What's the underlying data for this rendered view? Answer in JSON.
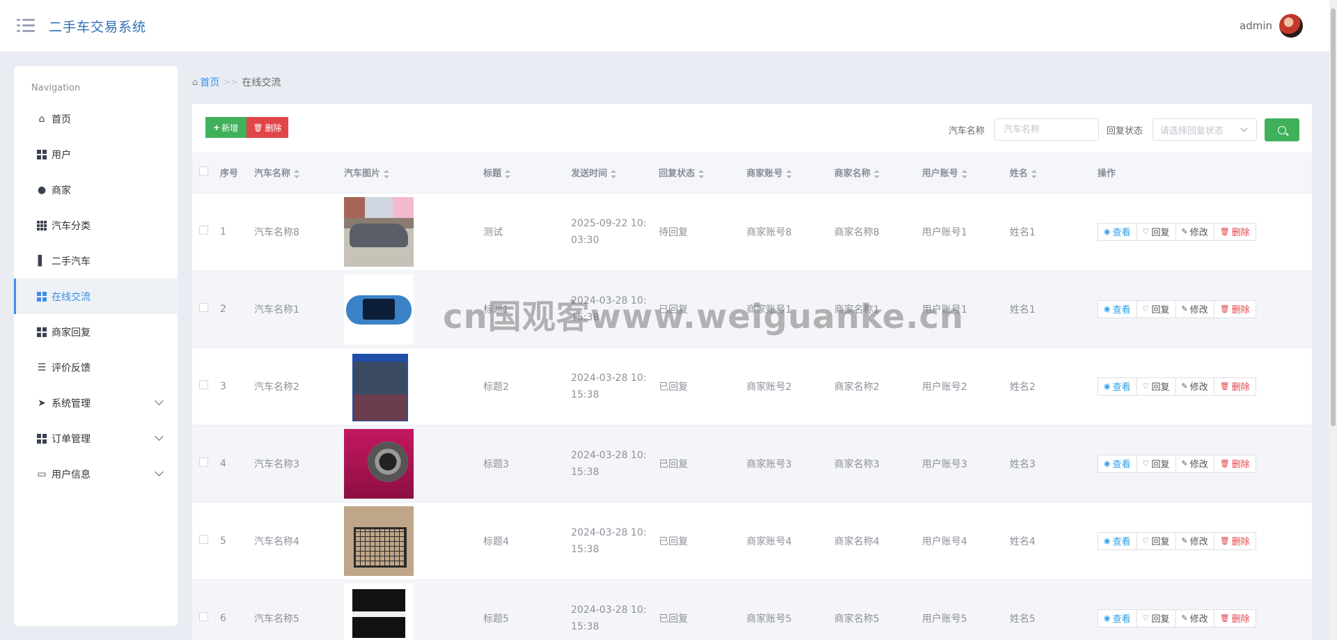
{
  "header": {
    "title": "二手车交易系统",
    "user": "admin"
  },
  "sidebar": {
    "title": "Navigation",
    "items": [
      {
        "label": "首页",
        "icon": "home-icon"
      },
      {
        "label": "用户",
        "icon": "grid-icon"
      },
      {
        "label": "商家",
        "icon": "bulb-icon"
      },
      {
        "label": "汽车分类",
        "icon": "apps-icon"
      },
      {
        "label": "二手汽车",
        "icon": "chart-icon"
      },
      {
        "label": "在线交流",
        "icon": "grid-icon",
        "active": true
      },
      {
        "label": "商家回复",
        "icon": "grid-icon"
      },
      {
        "label": "评价反馈",
        "icon": "list-icon"
      },
      {
        "label": "系统管理",
        "icon": "send-icon",
        "expandable": true
      },
      {
        "label": "订单管理",
        "icon": "grid-icon",
        "expandable": true
      },
      {
        "label": "用户信息",
        "icon": "card-icon",
        "expandable": true
      }
    ]
  },
  "breadcrumb": {
    "home": "首页",
    "separator": ">>",
    "current": "在线交流"
  },
  "toolbar": {
    "add_label": "新增",
    "delete_label": "删除",
    "search_car_label": "汽车名称",
    "search_car_placeholder": "汽车名称",
    "search_status_label": "回复状态",
    "search_status_placeholder": "请选择回复状态"
  },
  "table": {
    "columns": [
      "序号",
      "汽车名称",
      "汽车图片",
      "标题",
      "发送时间",
      "回复状态",
      "商家账号",
      "商家名称",
      "用户账号",
      "姓名",
      "操作"
    ],
    "rows": [
      {
        "index": "1",
        "car_name": "汽车名称8",
        "image": "minivan-photo",
        "title": "测试",
        "time_line1": "2025-09-22 10:",
        "time_line2": "03:30",
        "status": "待回复",
        "merchant_account": "商家账号8",
        "merchant_name": "商家名称8",
        "user_account": "用户账号1",
        "name": "姓名1"
      },
      {
        "index": "2",
        "car_name": "汽车名称1",
        "image": "handheld-console-photo",
        "title": "标题1",
        "time_line1": "2024-03-28 10:",
        "time_line2": "15:38",
        "status": "已回复",
        "merchant_account": "商家账号1",
        "merchant_name": "商家名称1",
        "user_account": "用户账号1",
        "name": "姓名1"
      },
      {
        "index": "3",
        "car_name": "汽车名称2",
        "image": "game-box-photo",
        "title": "标题2",
        "time_line1": "2024-03-28 10:",
        "time_line2": "15:38",
        "status": "已回复",
        "merchant_account": "商家账号2",
        "merchant_name": "商家名称2",
        "user_account": "用户账号2",
        "name": "姓名2"
      },
      {
        "index": "4",
        "car_name": "汽车名称3",
        "image": "camera-photo",
        "title": "标题3",
        "time_line1": "2024-03-28 10:",
        "time_line2": "15:38",
        "status": "已回复",
        "merchant_account": "商家账号3",
        "merchant_name": "商家名称3",
        "user_account": "用户账号3",
        "name": "姓名3"
      },
      {
        "index": "5",
        "car_name": "汽车名称4",
        "image": "basket-photo",
        "title": "标题4",
        "time_line1": "2024-03-28 10:",
        "time_line2": "15:38",
        "status": "已回复",
        "merchant_account": "商家账号4",
        "merchant_name": "商家名称4",
        "user_account": "用户账号4",
        "name": "姓名4"
      },
      {
        "index": "6",
        "car_name": "汽车名称5",
        "image": "piano-photo",
        "title": "标题5",
        "time_line1": "2024-03-28 10:",
        "time_line2": "15:38",
        "status": "已回复",
        "merchant_account": "商家账号5",
        "merchant_name": "商家名称5",
        "user_account": "用户账号5",
        "name": "姓名5"
      }
    ],
    "actions": {
      "view": "查看",
      "reply": "回复",
      "edit": "修改",
      "delete": "删除"
    }
  },
  "watermark": "cn国观客www.weiguanke.cn",
  "colors": {
    "primary": "#3a8ee6",
    "success": "#3fb15b",
    "danger": "#e0454a",
    "background": "#e9ecf3"
  }
}
